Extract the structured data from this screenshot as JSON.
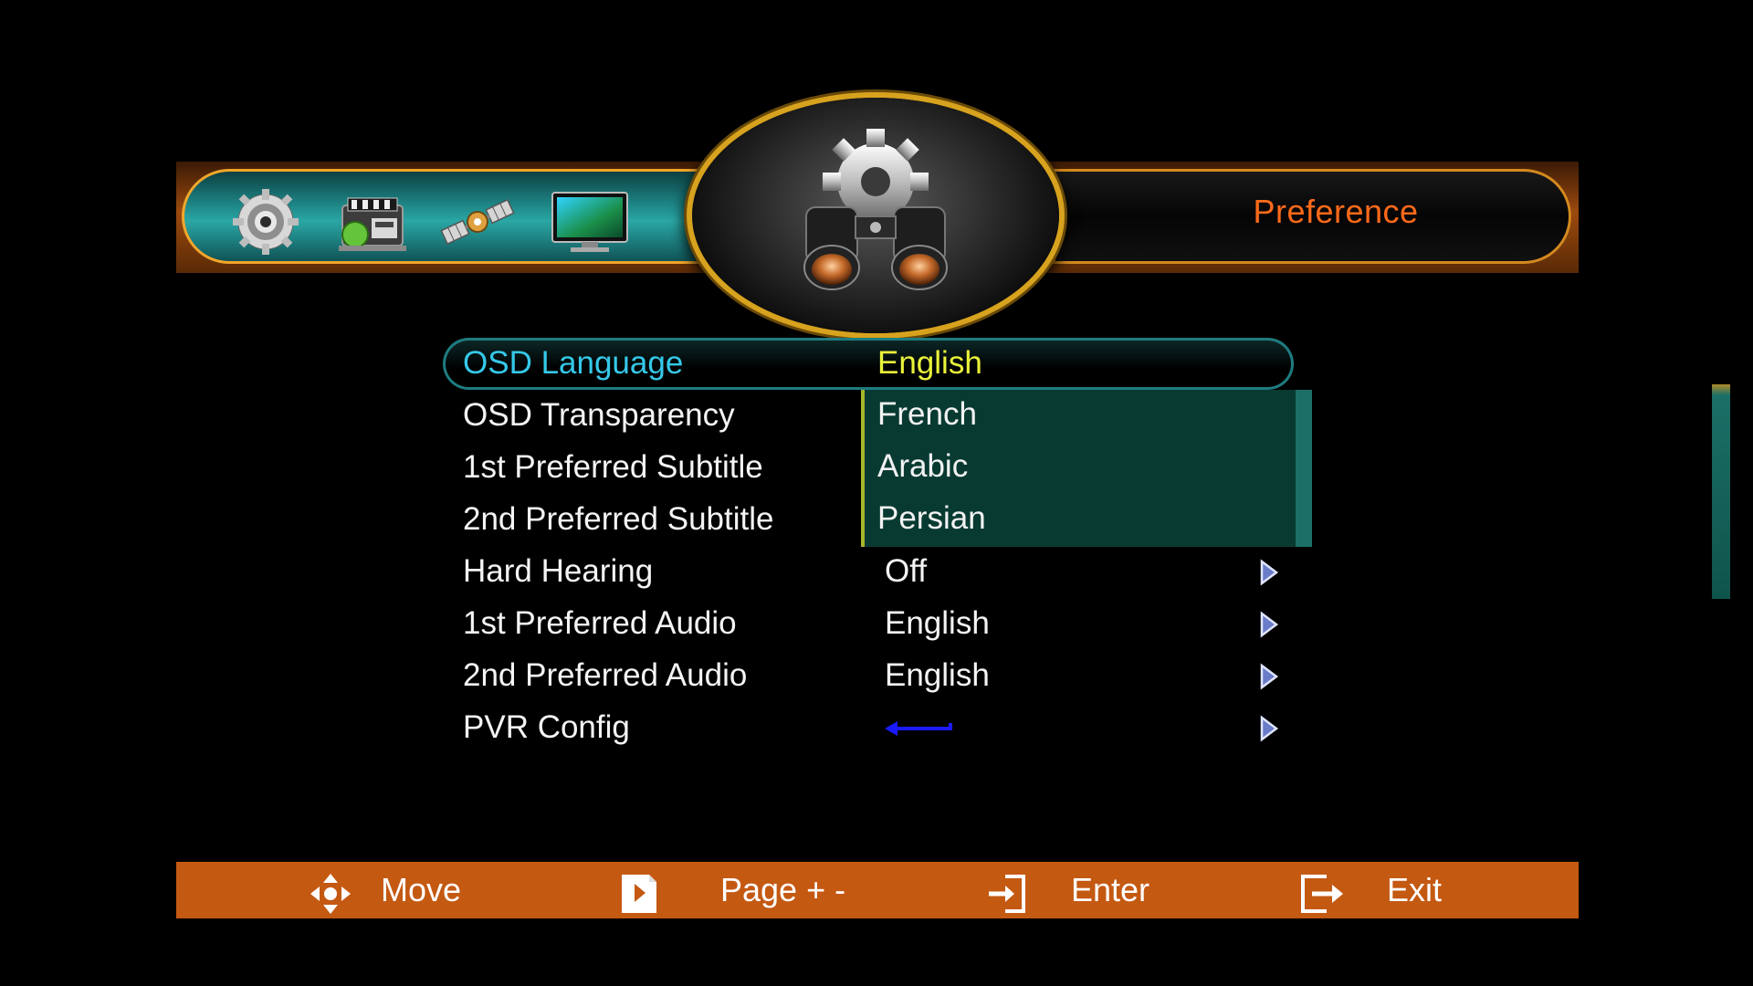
{
  "header": {
    "title": "Preference",
    "categories": [
      "installation-icon",
      "media-icon",
      "satellite-icon",
      "tv-icon"
    ],
    "center_icon": "gear-binoculars-icon"
  },
  "menu": {
    "rows": [
      {
        "label": "OSD Language",
        "value": "English",
        "selected": true
      },
      {
        "label": "OSD Transparency",
        "value": ""
      },
      {
        "label": "1st Preferred Subtitle",
        "value": ""
      },
      {
        "label": "2nd Preferred Subtitle",
        "value": ""
      },
      {
        "label": "Hard Hearing",
        "value": "Off"
      },
      {
        "label": "1st Preferred Audio",
        "value": "English"
      },
      {
        "label": "2nd Preferred Audio",
        "value": "English"
      },
      {
        "label": "PVR Config",
        "value": ""
      }
    ],
    "dropdown_options": [
      "French",
      "Arabic",
      "Persian"
    ]
  },
  "footer": {
    "move_label": "Move",
    "page_label": "Page + -",
    "enter_label": "Enter",
    "exit_label": "Exit"
  },
  "colors": {
    "title": "#ff6a1a",
    "selected_label": "#35c8e8",
    "selected_value": "#e9f23a",
    "footer_bg": "#c45912",
    "pvr_arrow": "#1a1aff"
  }
}
